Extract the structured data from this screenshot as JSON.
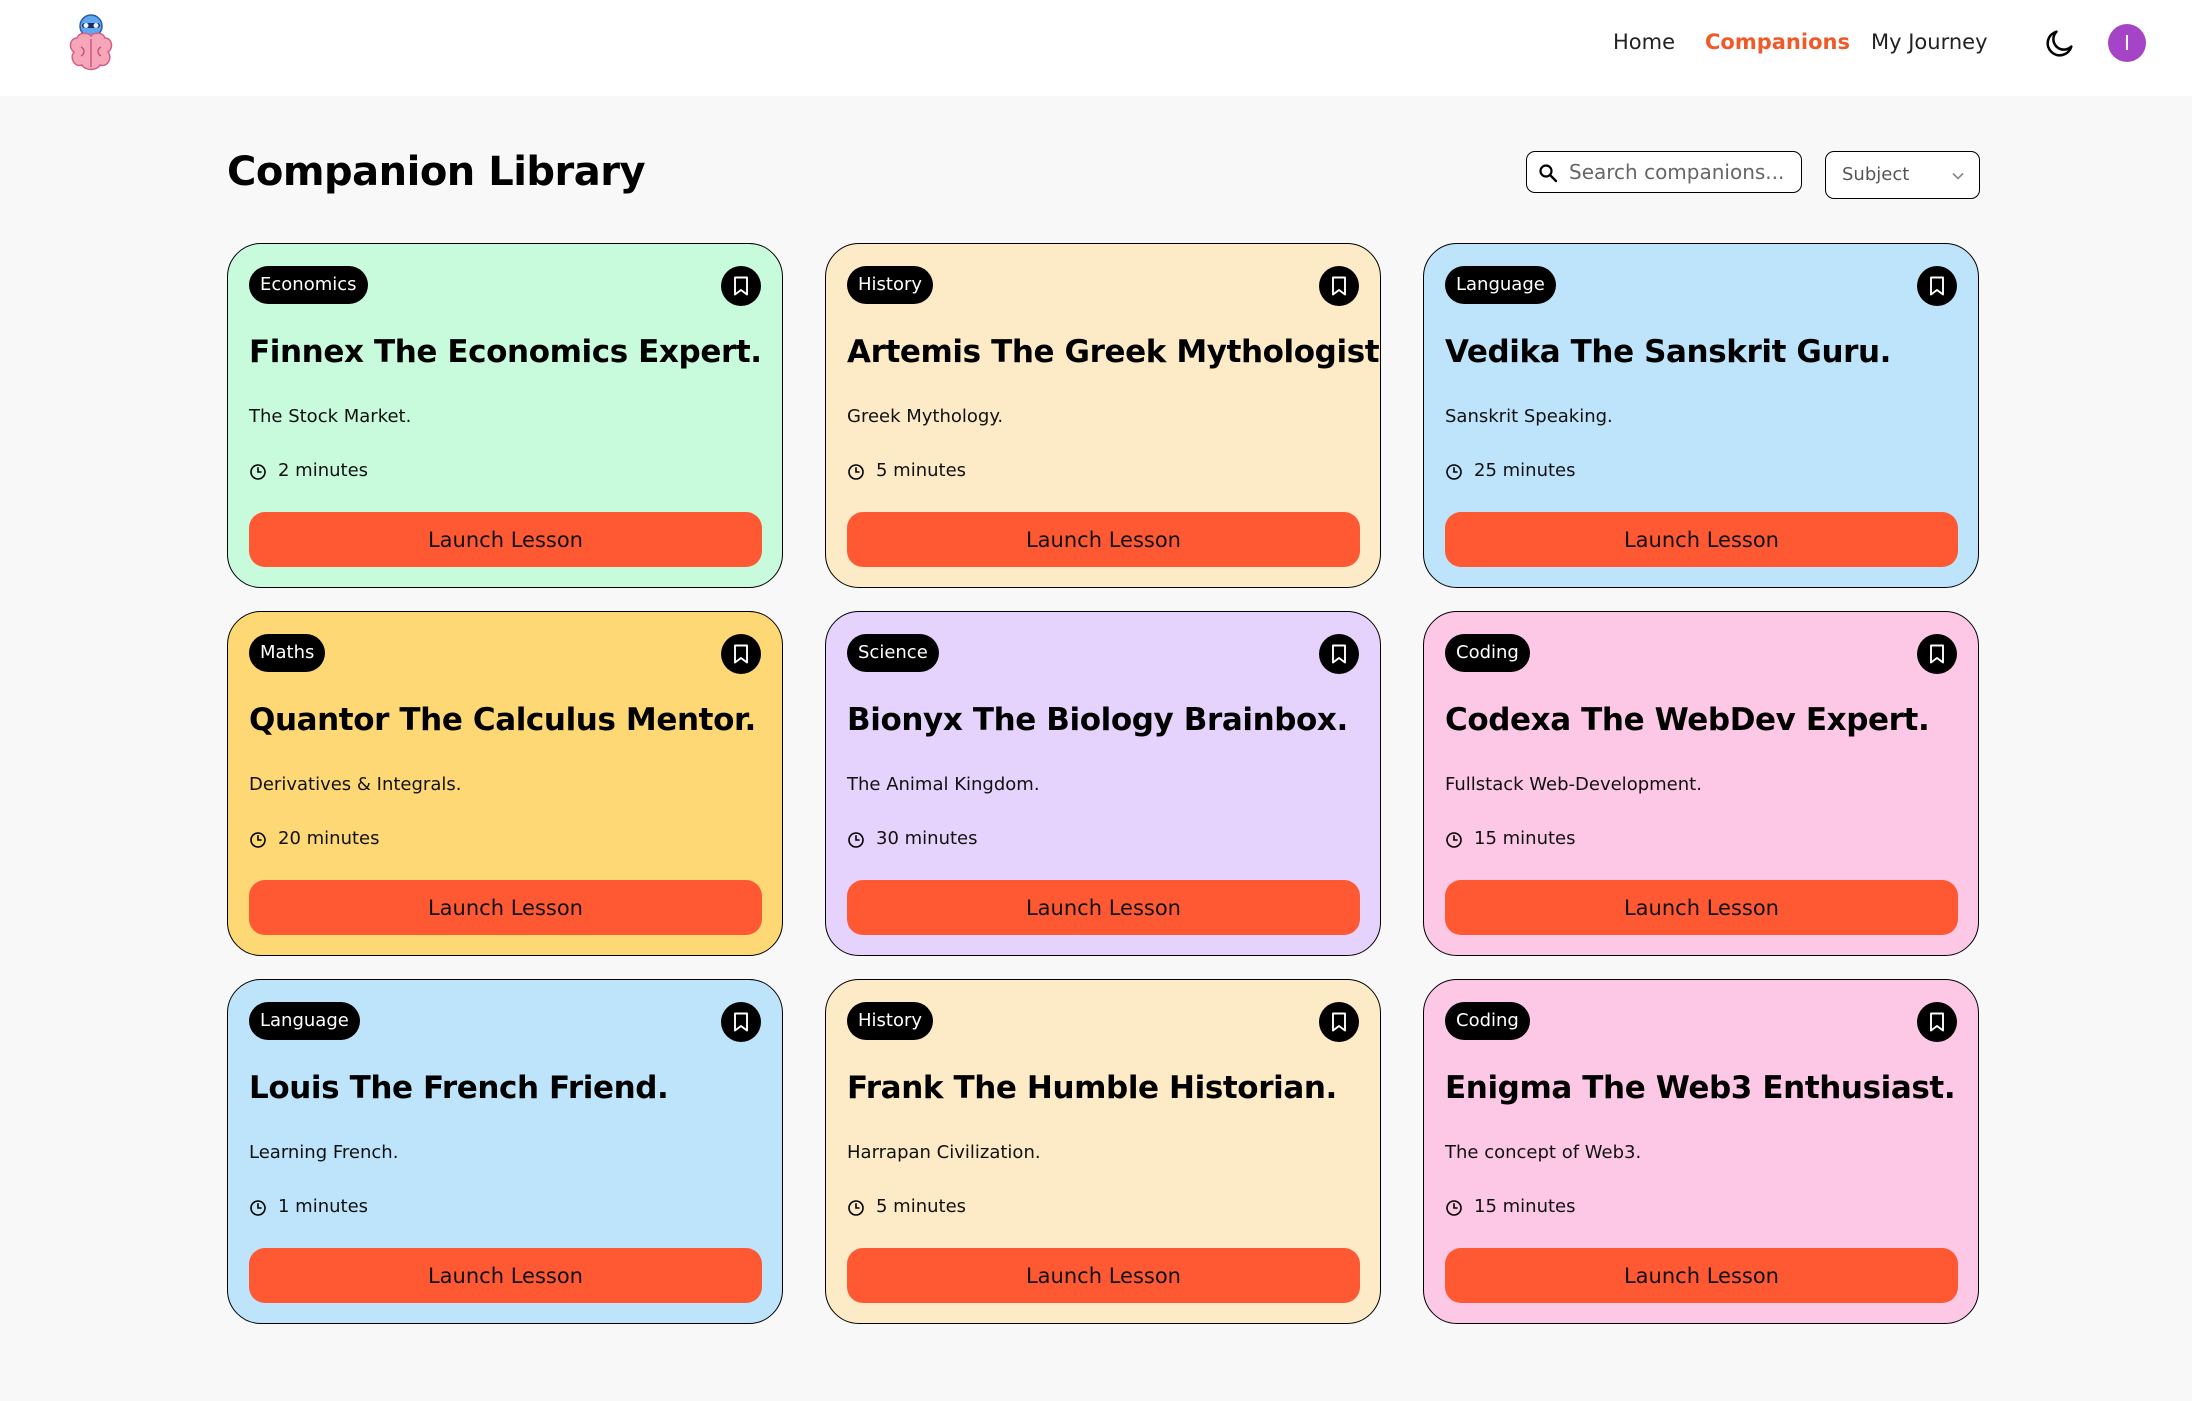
{
  "nav": {
    "links": [
      {
        "label": "Home",
        "active": false
      },
      {
        "label": "Companions",
        "active": true
      },
      {
        "label": "My Journey",
        "active": false
      }
    ],
    "avatar_initial": "I",
    "icons": {
      "logo": "brain-logo-icon",
      "theme": "moon-icon"
    },
    "accent_color": "#f05a2a"
  },
  "page": {
    "title": "Companion Library",
    "search_placeholder": "Search companions...",
    "subject_select_label": "Subject"
  },
  "cards": [
    {
      "subject": "Economics",
      "title": "Finnex The Economics Expert.",
      "topic": "The Stock Market.",
      "duration": "2 minutes",
      "button": "Launch Lesson",
      "color": "#c8fadc"
    },
    {
      "subject": "History",
      "title": "Artemis The Greek Mythologist.",
      "topic": "Greek Mythology.",
      "duration": "5 minutes",
      "button": "Launch Lesson",
      "color": "#fdeac7"
    },
    {
      "subject": "Language",
      "title": "Vedika The Sanskrit Guru.",
      "topic": "Sanskrit Speaking.",
      "duration": "25 minutes",
      "button": "Launch Lesson",
      "color": "#bde4fb"
    },
    {
      "subject": "Maths",
      "title": "Quantor The Calculus Mentor.",
      "topic": "Derivatives & Integrals.",
      "duration": "20 minutes",
      "button": "Launch Lesson",
      "color": "#fdd874"
    },
    {
      "subject": "Science",
      "title": "Bionyx The Biology Brainbox.",
      "topic": "The Animal Kingdom.",
      "duration": "30 minutes",
      "button": "Launch Lesson",
      "color": "#e6d3fd"
    },
    {
      "subject": "Coding",
      "title": "Codexa The WebDev Expert.",
      "topic": "Fullstack Web-Development.",
      "duration": "15 minutes",
      "button": "Launch Lesson",
      "color": "#fcc8e6"
    },
    {
      "subject": "Language",
      "title": "Louis The French Friend.",
      "topic": "Learning French.",
      "duration": "1 minutes",
      "button": "Launch Lesson",
      "color": "#bde4fb"
    },
    {
      "subject": "History",
      "title": "Frank The Humble Historian.",
      "topic": "Harrapan Civilization.",
      "duration": "5 minutes",
      "button": "Launch Lesson",
      "color": "#fdeac7"
    },
    {
      "subject": "Coding",
      "title": "Enigma The Web3 Enthusiast.",
      "topic": "The concept of Web3.",
      "duration": "15 minutes",
      "button": "Launch Lesson",
      "color": "#fcc8e6"
    }
  ],
  "button_color": "#fe5933"
}
